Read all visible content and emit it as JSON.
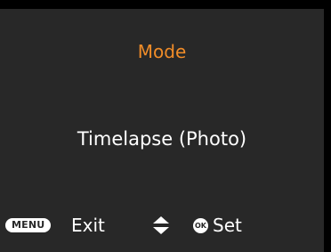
{
  "screen": {
    "title": "Mode",
    "value": "Timelapse (Photo)"
  },
  "footer": {
    "menu_key_label": "MENU",
    "exit_label": "Exit",
    "ok_key_label": "OK",
    "set_label": "Set",
    "navigate_icon": "up-down-arrows-icon"
  },
  "colors": {
    "background": "#282828",
    "title": "#f08c28",
    "text": "#ffffff"
  }
}
